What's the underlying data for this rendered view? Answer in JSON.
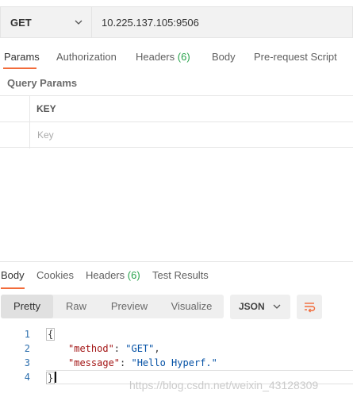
{
  "request": {
    "method": "GET",
    "url": "10.225.137.105:9506"
  },
  "request_tabs": [
    {
      "label": "Params",
      "count": "",
      "active": true
    },
    {
      "label": "Authorization",
      "count": "",
      "active": false
    },
    {
      "label": "Headers",
      "count": "(6)",
      "active": false
    },
    {
      "label": "Body",
      "count": "",
      "active": false
    },
    {
      "label": "Pre-request Script",
      "count": "",
      "active": false
    }
  ],
  "query_params": {
    "title": "Query Params",
    "column_key": "KEY",
    "key_placeholder": "Key"
  },
  "response_tabs": [
    {
      "label": "Body",
      "count": "",
      "active": true
    },
    {
      "label": "Cookies",
      "count": "",
      "active": false
    },
    {
      "label": "Headers",
      "count": "(6)",
      "active": false
    },
    {
      "label": "Test Results",
      "count": "",
      "active": false
    }
  ],
  "view_modes": [
    {
      "label": "Pretty",
      "active": true
    },
    {
      "label": "Raw",
      "active": false
    },
    {
      "label": "Preview",
      "active": false
    },
    {
      "label": "Visualize",
      "active": false
    }
  ],
  "format": "JSON",
  "icons": {
    "method_dropdown": "chevron-down-icon",
    "format_dropdown": "chevron-down-icon",
    "wrap": "wrap-lines-icon"
  },
  "colors": {
    "accent": "#f26b3a",
    "count_green": "#27a34b",
    "json_key": "#a31515",
    "json_string": "#0451a5",
    "line_number": "#2c6ead"
  },
  "response_body": {
    "lines": [
      {
        "num": "1",
        "open": "{"
      },
      {
        "num": "2",
        "key": "\"method\"",
        "sep": ": ",
        "value": "\"GET\"",
        "end": ","
      },
      {
        "num": "3",
        "key": "\"message\"",
        "sep": ": ",
        "value": "\"Hello Hyperf.\"",
        "end": ""
      },
      {
        "num": "4",
        "close": "}"
      }
    ]
  },
  "watermark": "https://blog.csdn.net/weixin_43128309"
}
